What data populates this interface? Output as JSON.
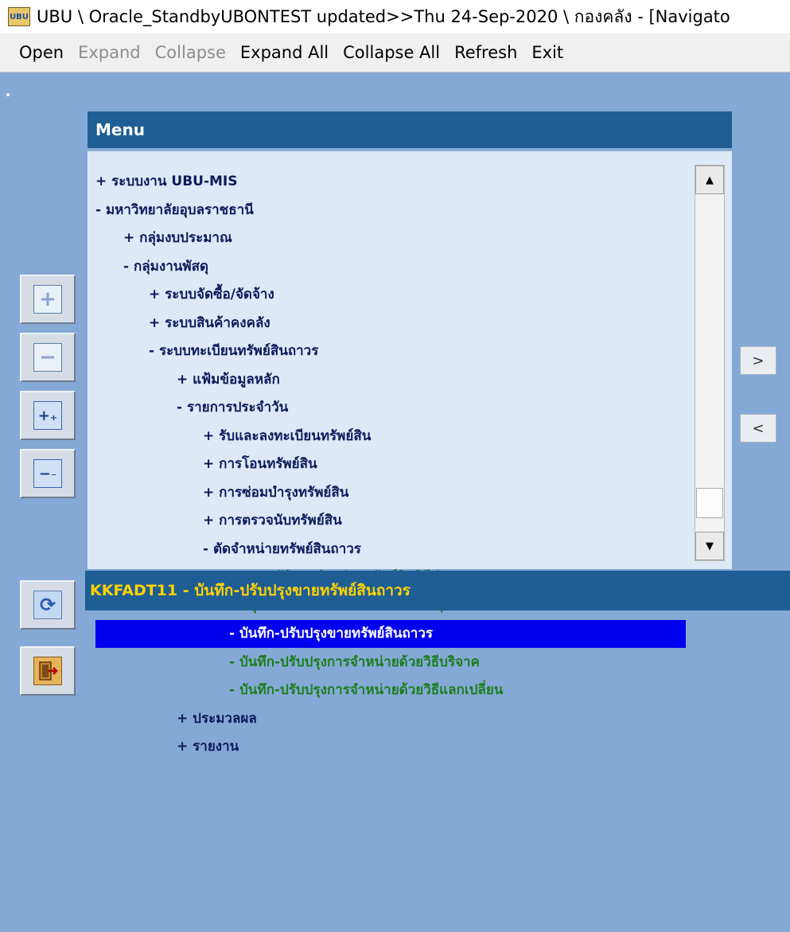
{
  "window": {
    "title": "UBU \\ Oracle_StandbyUBONTEST updated>>Thu 24-Sep-2020 \\ กองคลัง - [Navigato"
  },
  "menubar": {
    "items": [
      {
        "label": "Open",
        "enabled": true
      },
      {
        "label": "Expand",
        "enabled": false
      },
      {
        "label": "Collapse",
        "enabled": false
      },
      {
        "label": "Expand All",
        "enabled": true
      },
      {
        "label": "Collapse All",
        "enabled": true
      },
      {
        "label": "Refresh",
        "enabled": true
      },
      {
        "label": "Exit",
        "enabled": true
      }
    ]
  },
  "panel": {
    "title": "Menu"
  },
  "tree": {
    "items": [
      {
        "label": "+ ระบบงาน UBU-MIS",
        "level": 0,
        "type": "node"
      },
      {
        "label": "- มหาวิทยาลัยอุบลราชธานี",
        "level": 0,
        "type": "node"
      },
      {
        "label": "+ กลุ่มงบประมาณ",
        "level": 1,
        "type": "node"
      },
      {
        "label": "- กลุ่มงานพัสดุ",
        "level": 1,
        "type": "node"
      },
      {
        "label": "+ ระบบจัดซื้อ/จัดจ้าง",
        "level": 2,
        "type": "node"
      },
      {
        "label": "+ ระบบสินค้าคงคลัง",
        "level": 2,
        "type": "node"
      },
      {
        "label": "- ระบบทะเบียนทรัพย์สินถาวร",
        "level": 2,
        "type": "node"
      },
      {
        "label": "+ แฟ้มข้อมูลหลัก",
        "level": 3,
        "type": "node"
      },
      {
        "label": "- รายการประจำวัน",
        "level": 3,
        "type": "node"
      },
      {
        "label": "+ รับและลงทะเบียนทรัพย์สิน",
        "level": 4,
        "type": "node"
      },
      {
        "label": "+ การโอนทรัพย์สิน",
        "level": 4,
        "type": "node"
      },
      {
        "label": "+ การซ่อมบำรุงทรัพย์สิน",
        "level": 4,
        "type": "node"
      },
      {
        "label": "+ การตรวจนับทรัพย์สิน",
        "level": 4,
        "type": "node"
      },
      {
        "label": "- ตัดจำหน่ายทรัพย์สินถาวร",
        "level": 4,
        "type": "node"
      },
      {
        "label": "- ขออนุมัติการจำหน่ายทรัพย์สินวิธีต่างๆ",
        "level": 5,
        "type": "leaf"
      },
      {
        "label": "- อนุมัติการจำหน่ายทรัพย์สินวิธีต่างๆ",
        "level": 5,
        "type": "leaf"
      },
      {
        "label": "- บันทึก-ปรับปรุงขายทรัพย์สินถาวร",
        "level": 5,
        "type": "leaf",
        "selected": true
      },
      {
        "label": "- บันทึก-ปรับปรุงการจำหน่ายด้วยวิธีบริจาค",
        "level": 5,
        "type": "leaf"
      },
      {
        "label": "- บันทึก-ปรับปรุงการจำหน่ายด้วยวิธีแลกเปลี่ยน",
        "level": 5,
        "type": "leaf"
      },
      {
        "label": "+ ประมวลผล",
        "level": 3,
        "type": "node"
      },
      {
        "label": "+ รายงาน",
        "level": 3,
        "type": "node"
      }
    ]
  },
  "scrollbar": {
    "up_icon": "scroll-up-arrow",
    "down_icon": "scroll-down-arrow",
    "position": 0.95
  },
  "status": {
    "text": "KKFADT11 - บันทึก-ปรับปรุงขายทรัพย์สินถาวร"
  },
  "side_buttons": [
    {
      "name": "expand-button",
      "icon": "plus-icon",
      "glyph": "+",
      "enabled": false
    },
    {
      "name": "collapse-button",
      "icon": "minus-icon",
      "glyph": "−",
      "enabled": false
    },
    {
      "name": "expand-all-button",
      "icon": "expand-all-icon",
      "glyph": "⁺₊",
      "enabled": true
    },
    {
      "name": "collapse-all-button",
      "icon": "collapse-all-icon",
      "glyph": "−",
      "enabled": true
    },
    {
      "name": "refresh-button",
      "icon": "refresh-icon",
      "glyph": "⟳",
      "enabled": true
    },
    {
      "name": "exit-button",
      "icon": "exit-door-icon",
      "glyph": "⇥",
      "enabled": true
    }
  ],
  "nav_buttons": [
    {
      "name": "next-button",
      "glyph": ">"
    },
    {
      "name": "prev-button",
      "glyph": "<"
    }
  ],
  "colors": {
    "background": "#85a9d6",
    "panel_header": "#1f5e94",
    "tree_bg": "#dde9f6",
    "node_text": "#0d1a5c",
    "leaf_text": "#1c7d1c",
    "selection": "#0000ee",
    "status_text": "#ffd200"
  }
}
